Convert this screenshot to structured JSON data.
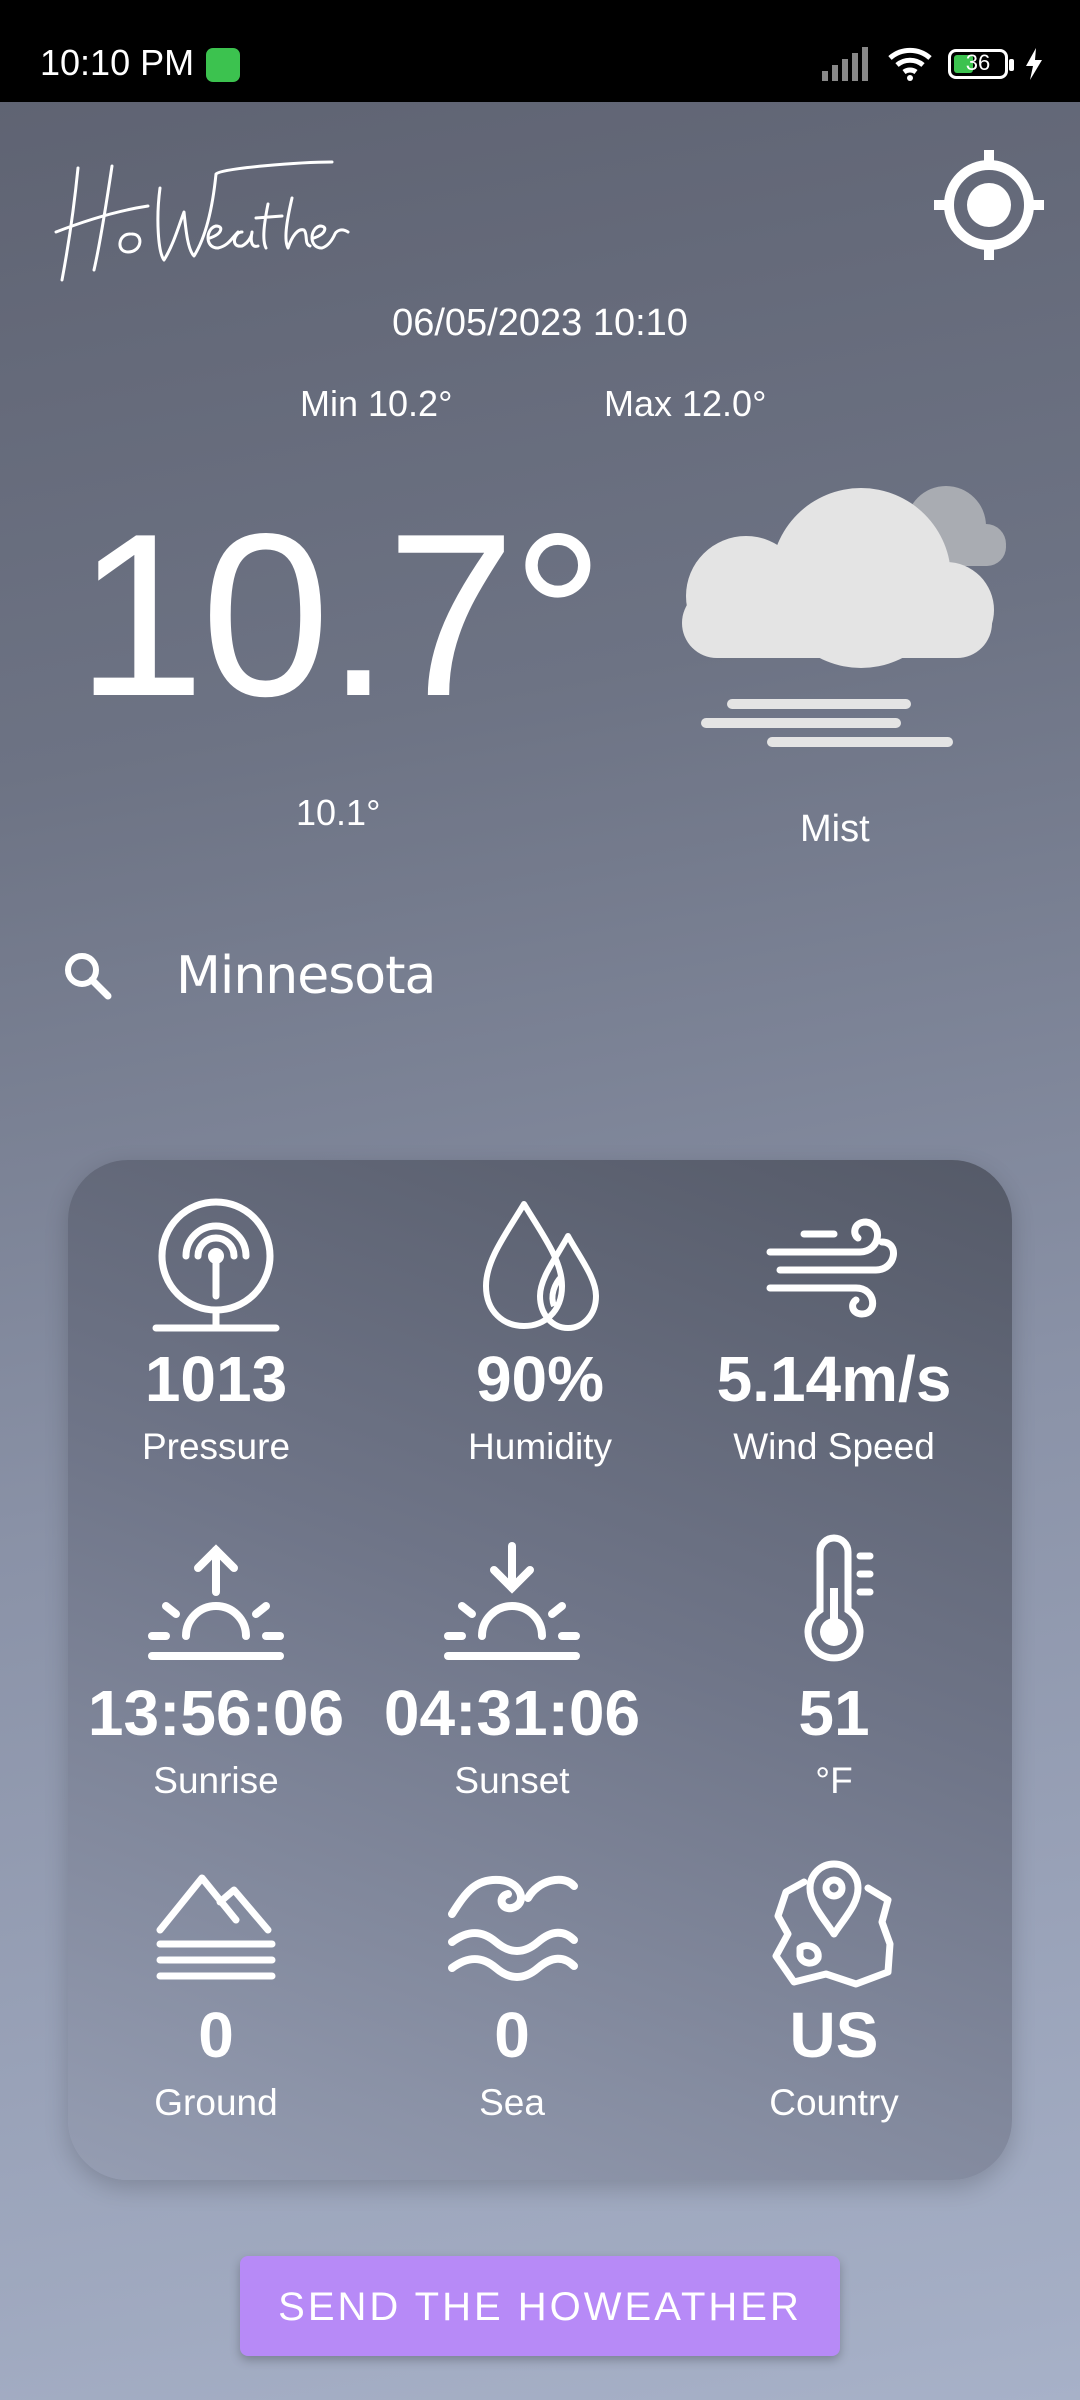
{
  "status_bar": {
    "time": "10:10 PM",
    "battery": "36"
  },
  "header": {
    "logo_text": "HoWeather"
  },
  "weather": {
    "datetime": "06/05/2023 10:10",
    "min": "Min 10.2°",
    "max": "Max 12.0°",
    "temperature": "10.7°",
    "feels_like": "10.1°",
    "condition": "Mist",
    "icon": "mist-cloud-icon"
  },
  "search": {
    "value": "Minnesota"
  },
  "details": [
    {
      "value": "1013",
      "label": "Pressure",
      "icon": "pressure-icon"
    },
    {
      "value": "90%",
      "label": "Humidity",
      "icon": "humidity-icon"
    },
    {
      "value": "5.14m/s",
      "label": "Wind Speed",
      "icon": "wind-icon"
    },
    {
      "value": "13:56:06",
      "label": "Sunrise",
      "icon": "sunrise-icon"
    },
    {
      "value": "04:31:06",
      "label": "Sunset",
      "icon": "sunset-icon"
    },
    {
      "value": "51",
      "label": "°F",
      "icon": "thermometer-icon"
    },
    {
      "value": "0",
      "label": "Ground",
      "icon": "ground-icon"
    },
    {
      "value": "0",
      "label": "Sea",
      "icon": "sea-icon"
    },
    {
      "value": "US",
      "label": "Country",
      "icon": "map-pin-icon"
    }
  ],
  "actions": {
    "send_label": "SEND THE HOWEATHER"
  },
  "colors": {
    "accent": "#b78af7",
    "status_green": "#3cc24f"
  }
}
